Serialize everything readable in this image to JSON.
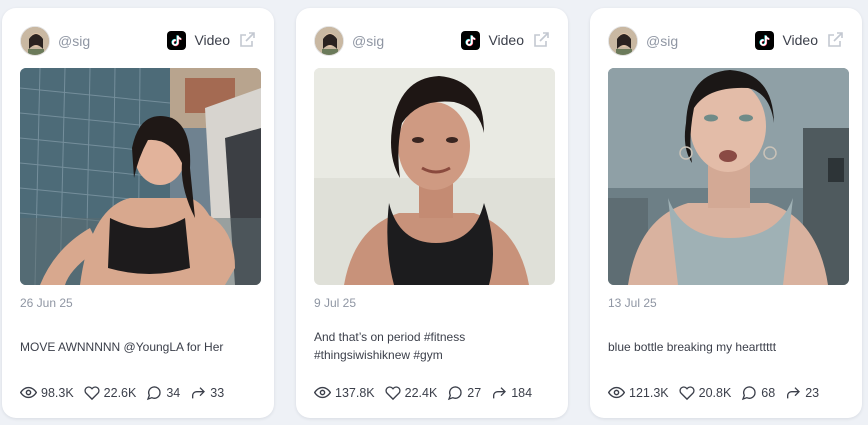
{
  "cards": [
    {
      "handle": "@sig",
      "platform": "Video",
      "platform_icon": "tiktok-icon",
      "date": "26 Jun 25",
      "caption": "MOVE AWNNNNN @YoungLA for Her",
      "stats": {
        "views": "98.3K",
        "likes": "22.6K",
        "comments": "34",
        "shares": "33"
      }
    },
    {
      "handle": "@sig",
      "platform": "Video",
      "platform_icon": "tiktok-icon",
      "date": "9 Jul 25",
      "caption": "And that’s on period #fitness #thingsiwishiknew #gym",
      "stats": {
        "views": "137.8K",
        "likes": "22.4K",
        "comments": "27",
        "shares": "184"
      }
    },
    {
      "handle": "@sig",
      "platform": "Video",
      "platform_icon": "tiktok-icon",
      "date": "13 Jul 25",
      "caption": "blue bottle breaking my hearttttt",
      "stats": {
        "views": "121.3K",
        "likes": "20.8K",
        "comments": "68",
        "shares": "23"
      }
    }
  ]
}
